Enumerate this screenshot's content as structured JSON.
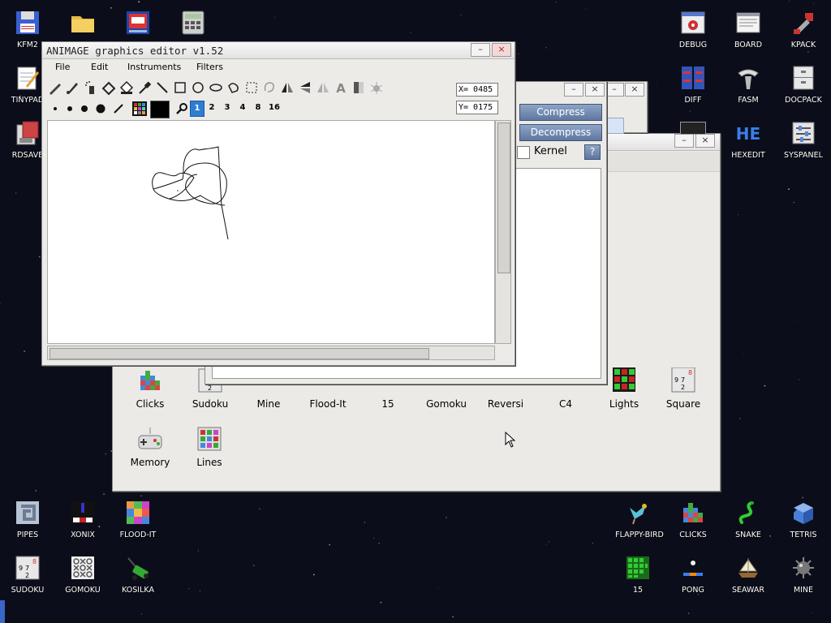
{
  "desktop": {
    "left_icons": [
      {
        "label": "KFM2",
        "icon": "floppy-icon"
      },
      {
        "label": "",
        "icon": "folder-icon"
      },
      {
        "label": "",
        "icon": "screenshot-icon"
      },
      {
        "label": "",
        "icon": "calculator-icon"
      },
      {
        "label": "TINYPAD",
        "icon": "notepad-icon"
      },
      {
        "label": "RDSAVE",
        "icon": "rdsave-icon"
      }
    ],
    "right_icons": [
      {
        "label": "DEBUG",
        "icon": "debug-icon"
      },
      {
        "label": "BOARD",
        "icon": "board-icon"
      },
      {
        "label": "KPACK",
        "icon": "kpack-icon"
      },
      {
        "label": "DIFF",
        "icon": "diff-icon"
      },
      {
        "label": "FASM",
        "icon": "fasm-icon"
      },
      {
        "label": "DOCPACK",
        "icon": "docpack-icon"
      },
      {
        "label": "HEXEDIT",
        "icon": "hexedit-icon"
      },
      {
        "label": "SYSPANEL",
        "icon": "syspanel-icon"
      }
    ],
    "bottom_icons": [
      {
        "label": "PIPES",
        "icon": "pipes-icon"
      },
      {
        "label": "XONIX",
        "icon": "xonix-icon"
      },
      {
        "label": "FLOOD-IT",
        "icon": "flood-it-icon"
      },
      {
        "label": "FLAPPY-BIRD",
        "icon": "flappy-bird-icon"
      },
      {
        "label": "CLICKS",
        "icon": "clicks-icon"
      },
      {
        "label": "SNAKE",
        "icon": "snake-icon"
      },
      {
        "label": "TETRIS",
        "icon": "tetris-icon"
      },
      {
        "label": "SUDOKU",
        "icon": "sudoku-icon"
      },
      {
        "label": "GOMOKU",
        "icon": "gomoku-icon"
      },
      {
        "label": "KOSILKA",
        "icon": "kosilka-icon"
      },
      {
        "label": "15",
        "icon": "fifteen-icon"
      },
      {
        "label": "PONG",
        "icon": "pong-icon"
      },
      {
        "label": "SEAWAR",
        "icon": "seawar-icon"
      },
      {
        "label": "MINE",
        "icon": "mine-icon"
      }
    ]
  },
  "games_window": {
    "row1": [
      "Clicks",
      "Sudoku",
      "Mine",
      "Flood-It",
      "15",
      "Gomoku",
      "Reversi",
      "C4",
      "Lights",
      "Square"
    ],
    "row2": [
      "Memory",
      "Lines"
    ]
  },
  "kpack_window": {
    "compress_label": "Compress",
    "decompress_label": "Decompress",
    "kernel_label": "Kernel",
    "help_label": "?"
  },
  "animage": {
    "title": "ANIMAGE graphics editor v1.52",
    "minimize_label": "–",
    "close_label": "×",
    "menu": [
      "File",
      "Edit",
      "Instruments",
      "Filters"
    ],
    "coord_x": "X= 0485",
    "coord_y": "Y= 0175",
    "brush_sizes": [
      "1",
      "2",
      "3",
      "4",
      "8",
      "16"
    ],
    "selected_size": "1"
  },
  "colors": {
    "accent": "#2d7dd2",
    "close": "#e06060"
  }
}
